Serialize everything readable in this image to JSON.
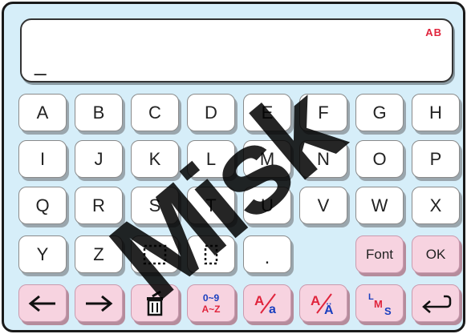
{
  "display": {
    "mode_indicator": "AB",
    "cursor": "_"
  },
  "keyboard": {
    "rows": [
      [
        "A",
        "B",
        "C",
        "D",
        "E",
        "F",
        "G",
        "H"
      ],
      [
        "I",
        "J",
        "K",
        "L",
        "M",
        "N",
        "O",
        "P"
      ],
      [
        "Q",
        "R",
        "S",
        "T",
        "U",
        "V",
        "W",
        "X"
      ],
      [
        "Y",
        "Z"
      ]
    ],
    "space_key_icons": [
      "dotted-square-wide-icon",
      "dotted-square-narrow-icon"
    ],
    "period_label": ".",
    "font_label": "Font",
    "ok_label": "OK"
  },
  "toolbar": {
    "left_arrow_icon": "arrow-left-icon",
    "right_arrow_icon": "arrow-right-icon",
    "delete_icon": "trash-delete-icon",
    "num_mode": {
      "top": "0~9",
      "bottom": "A~Z"
    },
    "case_key_1": {
      "upper": "A",
      "lower": "a"
    },
    "case_key_2": {
      "upper": "A",
      "lower": "Ä"
    },
    "size_key": {
      "l": "L",
      "m": "M",
      "s": "S"
    },
    "enter_icon": "return-arrow-icon"
  },
  "watermark": "Misk",
  "colors": {
    "background": "#d6eef9",
    "pink_key": "#f7d3e0",
    "accent_red": "#e0243c",
    "accent_blue": "#1a3fbf"
  }
}
